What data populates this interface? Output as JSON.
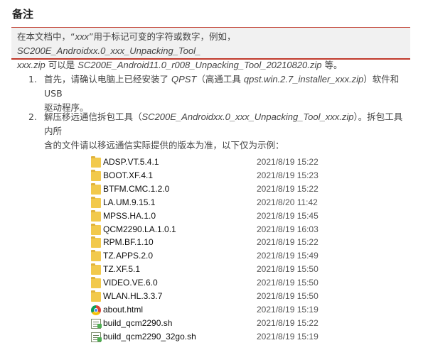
{
  "note": {
    "title": "备注",
    "line1_prefix": "在本文档中，“",
    "line1_var": "xxx",
    "line1_mid": "”用于标记可变的字符或数字，例如，",
    "line1_example": "SC200E_Androidxx.0_xxx_Unpacking_Tool_",
    "line2_example_tail": "xxx.zip",
    "line2_mid": " 可以是 ",
    "line2_example2": "SC200E_Android11.0_r008_Unpacking_Tool_20210820.zip",
    "line2_suffix": " 等。"
  },
  "steps": [
    {
      "num": "1.",
      "text_a": "首先，请确认电脑上已经安装了 ",
      "tool": "QPST",
      "text_b": "（高通工具 ",
      "installer": "qpst.win.2.7_installer_xxx.zip",
      "text_c": "）软件和 USB",
      "text_d": "驱动程序。"
    },
    {
      "num": "2.",
      "text_a": "解压移远通信拆包工具（",
      "package": "SC200E_Androidxx.0_xxx_Unpacking_Tool_xxx.zip",
      "text_b": "）。拆包工具内所",
      "text_c": "含的文件请以移远通信实际提供的版本为准，以下仅为示例："
    }
  ],
  "files": [
    {
      "icon": "folder-icon",
      "name": "ADSP.VT.5.4.1",
      "date": "2021/8/19 15:22"
    },
    {
      "icon": "folder-icon",
      "name": "BOOT.XF.4.1",
      "date": "2021/8/19 15:23"
    },
    {
      "icon": "folder-icon",
      "name": "BTFM.CMC.1.2.0",
      "date": "2021/8/19 15:22"
    },
    {
      "icon": "folder-icon",
      "name": "LA.UM.9.15.1",
      "date": "2021/8/20 11:42"
    },
    {
      "icon": "folder-icon",
      "name": "MPSS.HA.1.0",
      "date": "2021/8/19 15:45"
    },
    {
      "icon": "folder-icon",
      "name": "QCM2290.LA.1.0.1",
      "date": "2021/8/19 16:03"
    },
    {
      "icon": "folder-icon",
      "name": "RPM.BF.1.10",
      "date": "2021/8/19 15:22"
    },
    {
      "icon": "folder-icon",
      "name": "TZ.APPS.2.0",
      "date": "2021/8/19 15:49"
    },
    {
      "icon": "folder-icon",
      "name": "TZ.XF.5.1",
      "date": "2021/8/19 15:50"
    },
    {
      "icon": "folder-icon",
      "name": "VIDEO.VE.6.0",
      "date": "2021/8/19 15:50"
    },
    {
      "icon": "folder-icon",
      "name": "WLAN.HL.3.3.7",
      "date": "2021/8/19 15:50"
    },
    {
      "icon": "chrome-html-icon",
      "name": "about.html",
      "date": "2021/8/19 15:19"
    },
    {
      "icon": "shell-script-icon",
      "name": "build_qcm2290.sh",
      "date": "2021/8/19 15:22"
    },
    {
      "icon": "shell-script-icon",
      "name": "build_qcm2290_32go.sh",
      "date": "2021/8/19 15:19"
    }
  ],
  "colors": {
    "accent_border": "#c0392b",
    "note_bg": "#f1f1f1",
    "folder": "#f2c94c"
  }
}
